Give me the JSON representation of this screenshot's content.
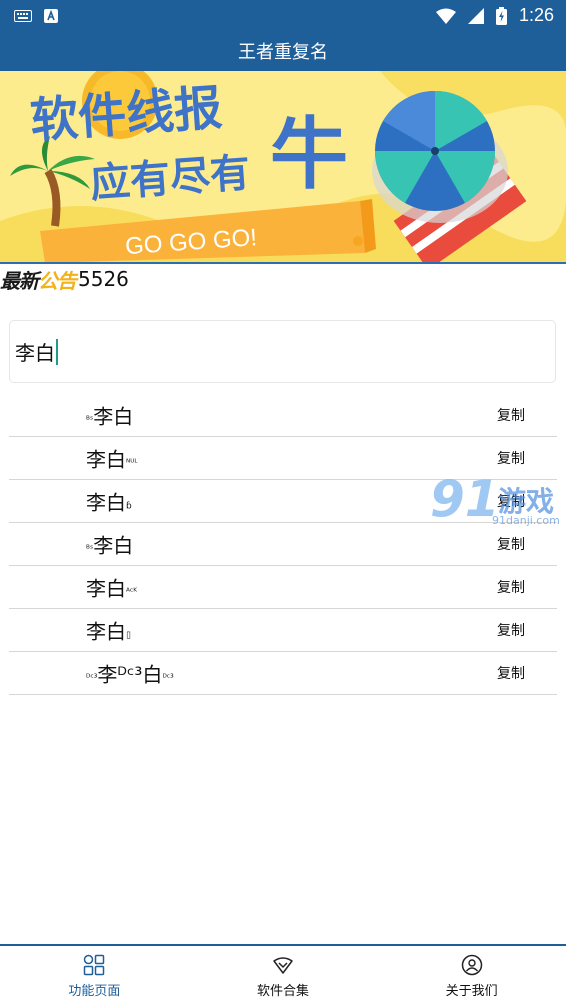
{
  "status_bar": {
    "time": "1:26"
  },
  "app_bar": {
    "title": "王者重复名"
  },
  "banner": {
    "line1": "软件线报",
    "line2": "应有尽有",
    "big_char": "牛",
    "ribbon": "GO GO GO!"
  },
  "notice": {
    "logo_part1": "最新",
    "logo_part2": "公告",
    "text": "5526"
  },
  "input": {
    "value": "李白"
  },
  "results": [
    {
      "prefix": "ᴮˢ",
      "name": "李白",
      "suffix": "",
      "copy": "复制"
    },
    {
      "prefix": "",
      "name": "李白",
      "suffix": "ᴺᵁᴸ",
      "copy": "复制"
    },
    {
      "prefix": "",
      "name": "李白",
      "suffix": "ɓ",
      "copy": "复制"
    },
    {
      "prefix": "ᴮˢ",
      "name": "李白",
      "suffix": "",
      "copy": "复制"
    },
    {
      "prefix": "",
      "name": "李白",
      "suffix": "ᴬᶜᴷ",
      "copy": "复制"
    },
    {
      "prefix": "",
      "name": "李白",
      "suffix": "▯",
      "copy": "复制"
    },
    {
      "prefix": "ᴰᶜ³",
      "name": "李ᴰᶜ³白",
      "suffix": "ᴰᶜ³",
      "copy": "复制"
    }
  ],
  "watermark": {
    "number": "91",
    "text": "游戏",
    "url": "91danji.com"
  },
  "bottom_nav": [
    {
      "label": "功能页面",
      "icon": "grid-icon",
      "active": true
    },
    {
      "label": "软件合集",
      "icon": "diamond-icon",
      "active": false
    },
    {
      "label": "关于我们",
      "icon": "user-icon",
      "active": false
    }
  ],
  "colors": {
    "primary": "#1e5e99",
    "banner_bg": "#fbeb8a",
    "accent_yellow": "#f2b21a"
  }
}
